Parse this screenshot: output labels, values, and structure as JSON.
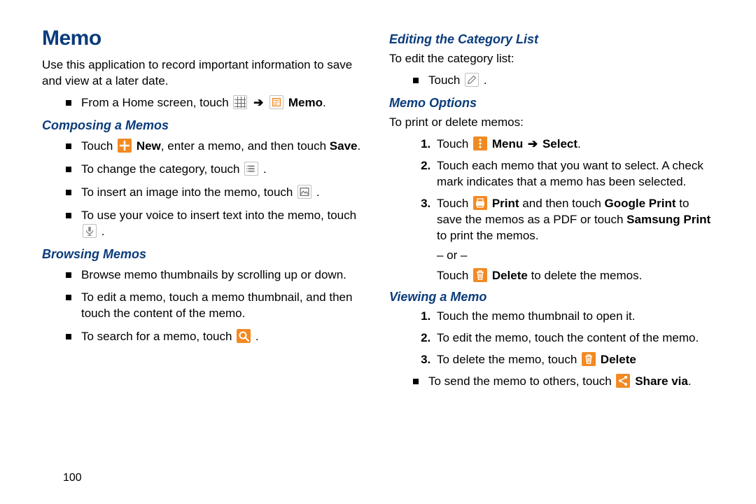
{
  "page_number": "100",
  "title": "Memo",
  "left": {
    "intro": "Use this application to record important information to save and view at a later date.",
    "home_pre": "From a Home screen, touch ",
    "home_post": " Memo",
    "composing": {
      "heading": "Composing a Memos",
      "i1_pre": "Touch ",
      "i1_mid": " New",
      "i1_post": ", enter a memo, and then touch ",
      "i1_save": "Save",
      "i2_pre": "To change the category, touch ",
      "i3_pre": "To insert an image into the memo, touch ",
      "i4_pre": "To use your voice to insert text into the memo, touch "
    },
    "browsing": {
      "heading": "Browsing Memos",
      "i1": "Browse memo thumbnails by scrolling up or down.",
      "i2": "To edit a memo, touch a memo thumbnail, and then touch the content of the memo.",
      "i3_pre": "To search for a memo, touch "
    }
  },
  "right": {
    "editcat": {
      "heading": "Editing the Category List",
      "intro": "To edit the category list:",
      "i1_pre": "Touch "
    },
    "options": {
      "heading": "Memo Options",
      "intro": "To print or delete memos:",
      "s1_pre": "Touch ",
      "s1_menu": "Menu",
      "s1_select": "Select",
      "s2": "Touch each memo that you want to select. A check mark indicates that a memo has been selected.",
      "s3_pre": "Touch ",
      "s3_print": "Print",
      "s3_mid": " and then touch ",
      "s3_gp": "Google Print",
      "s3_mid2": " to save the memos as a PDF or touch ",
      "s3_sp": "Samsung Print",
      "s3_post": " to print the memos.",
      "s3_or": "– or –",
      "s3b_pre": "Touch ",
      "s3b_del": "Delete",
      "s3b_post": " to delete the memos."
    },
    "viewing": {
      "heading": "Viewing a Memo",
      "s1": "Touch the memo thumbnail to open it.",
      "s2": "To edit the memo, touch the content of the memo.",
      "s3_pre": "To delete the memo, touch ",
      "s3_del": "Delete",
      "b1_pre": "To send the memo to others, touch ",
      "b1_share": "Share via"
    }
  },
  "period": "."
}
